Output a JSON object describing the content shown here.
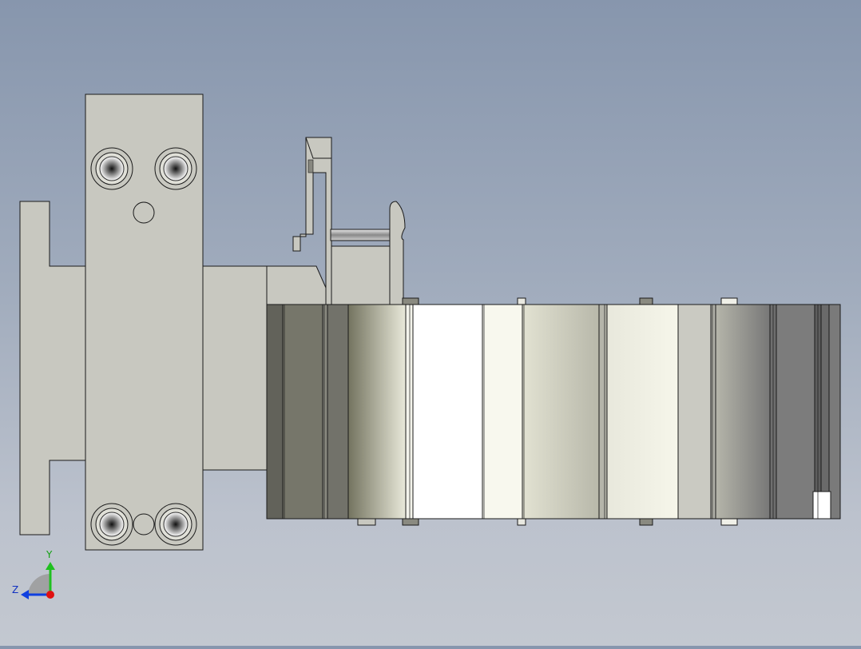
{
  "viewport": {
    "background_top": "#8796ad",
    "background_bottom": "#c3c8d0",
    "part_fill": "#c8c8c0",
    "edge_color": "#1a1a1a",
    "screw_icon": "torx-screw-icon"
  },
  "triad": {
    "y_label": "Y",
    "z_label": "Z",
    "x_color": "#e01010",
    "y_color": "#20c020",
    "z_color": "#1040e0"
  }
}
